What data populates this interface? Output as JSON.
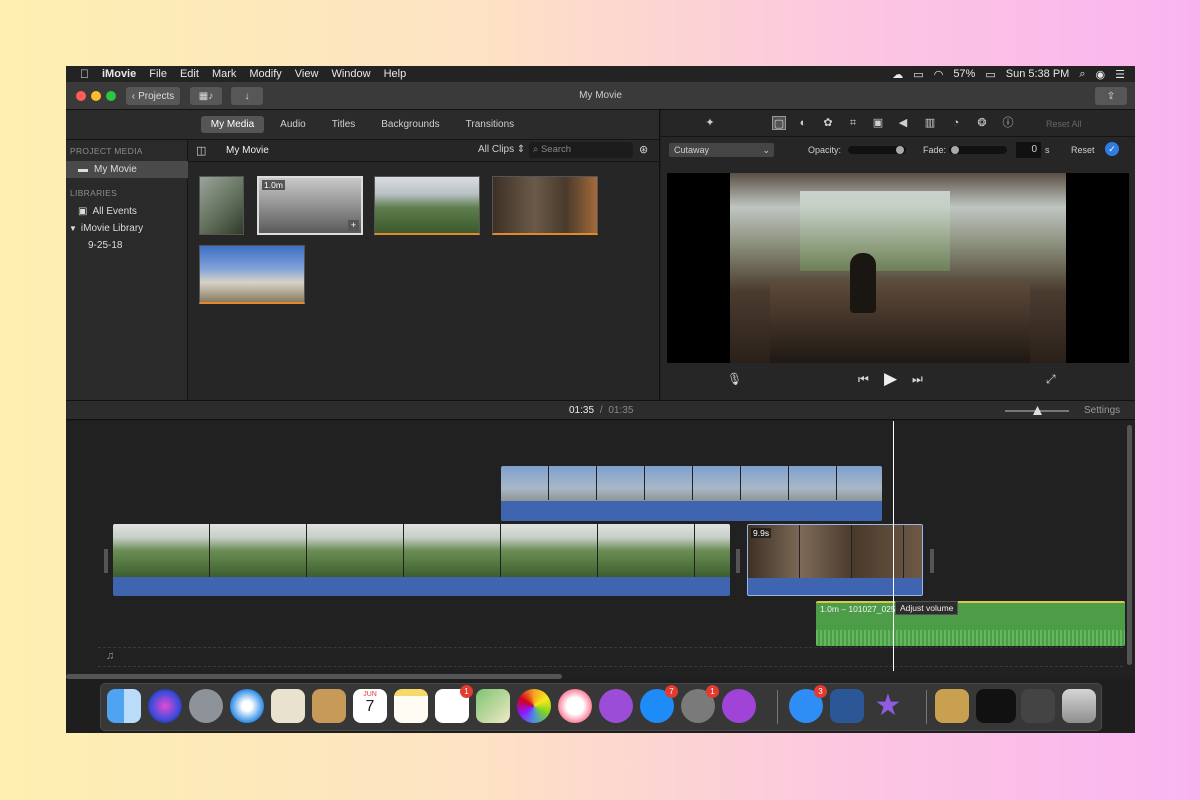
{
  "menubar": {
    "apple": "",
    "app": "iMovie",
    "items": [
      "File",
      "Edit",
      "Mark",
      "Modify",
      "View",
      "Window",
      "Help"
    ],
    "battery": "57%",
    "clock": "Sun 5:38 PM"
  },
  "toolbar": {
    "projects_label": "Projects",
    "window_title": "My Movie"
  },
  "browser": {
    "tabs": [
      "My Media",
      "Audio",
      "Titles",
      "Backgrounds",
      "Transitions"
    ],
    "active_tab": "My Media",
    "sidebar": {
      "project_media_header": "PROJECT MEDIA",
      "my_movie": "My Movie",
      "libraries_header": "LIBRARIES",
      "all_events": "All Events",
      "imovie_library": "iMovie Library",
      "event_date": "9-25-18"
    },
    "media_title": "My Movie",
    "filter": "All Clips",
    "search_placeholder": "Search",
    "selected_thumb_duration": "1.0m"
  },
  "viewer": {
    "cutaway": "Cutaway",
    "opacity_label": "Opacity:",
    "fade_label": "Fade:",
    "fade_value": "0",
    "fade_unit": "s",
    "reset": "Reset",
    "reset_all": "Reset All"
  },
  "timeline": {
    "current_time": "01:35",
    "separator": "/",
    "total_time": "01:35",
    "settings": "Settings",
    "cutaway_clip_label": "9.9s",
    "audio_clip_label": "1.0m – 101027_0251",
    "tooltip": "Adjust volume"
  },
  "dock": {
    "badges": {
      "reminders": "1",
      "appstore": "7",
      "prefs": "1",
      "messages": "3"
    },
    "calendar_month": "JUN",
    "calendar_day": "7"
  },
  "colors": {
    "audio_blue": "#3f64b0",
    "music_green": "#4c9c48",
    "playhead": "#ffffff",
    "accent": "#2f7de1"
  }
}
